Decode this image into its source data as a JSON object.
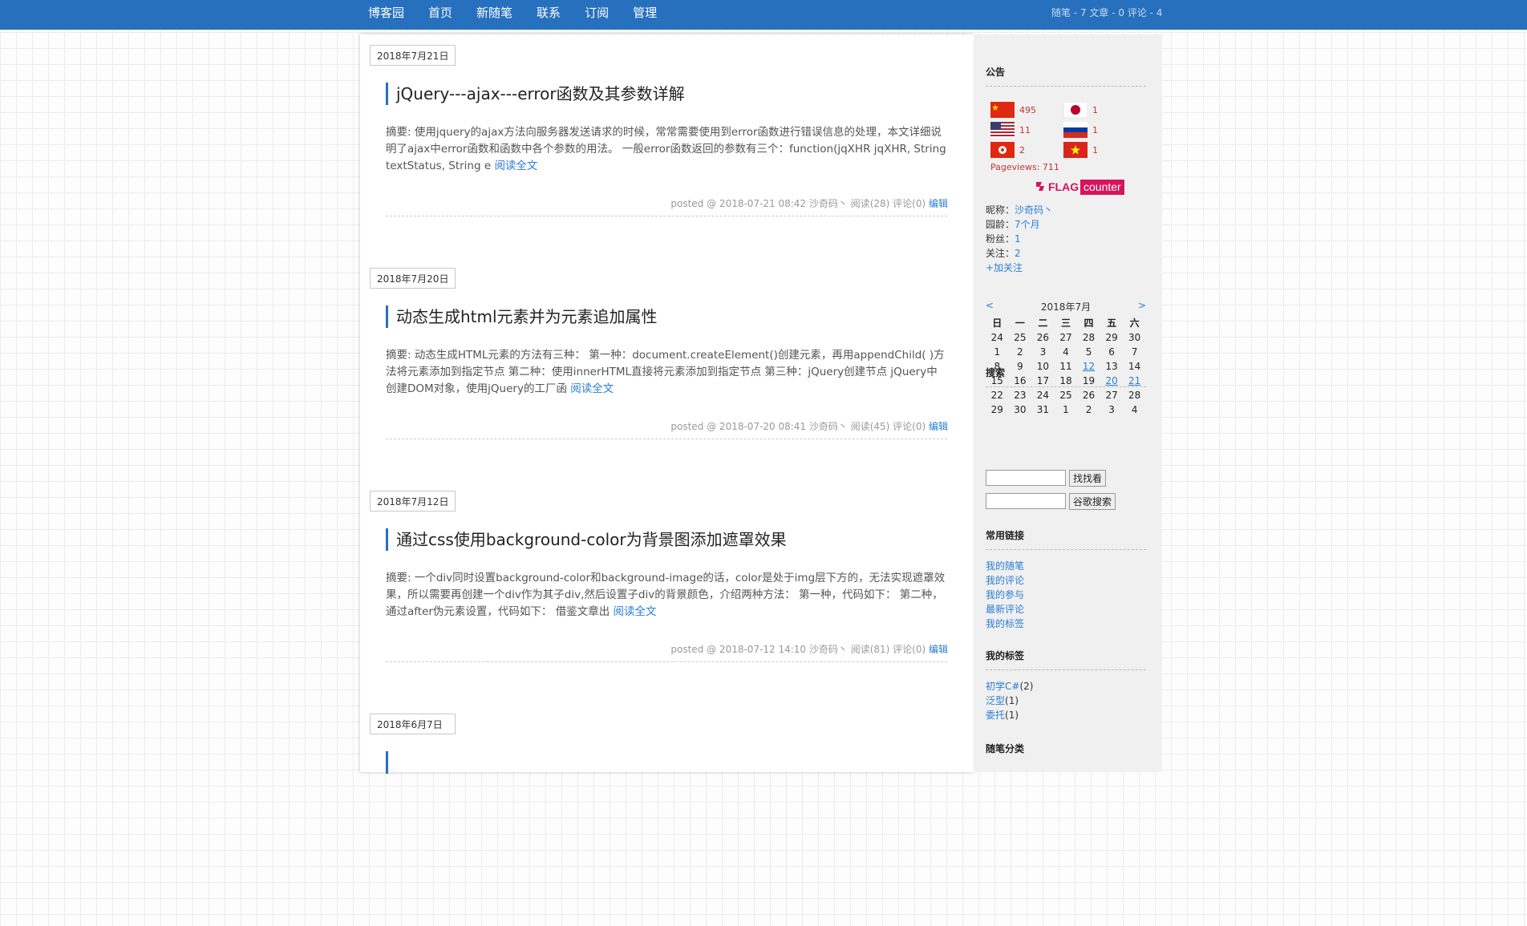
{
  "nav": {
    "items": [
      "博客园",
      "首页",
      "新随笔",
      "联系",
      "订阅",
      "管理"
    ],
    "stats": "随笔 - 7  文章 - 0  评论 - 4"
  },
  "posts": [
    {
      "date": "2018年7月21日",
      "title": "jQuery---ajax---error函数及其参数详解",
      "summary": "摘要: 使用jquery的ajax方法向服务器发送请求的时候，常常需要使用到error函数进行错误信息的处理，本文详细说明了ajax中error函数和函数中各个参数的用法。 一般error函数返回的参数有三个：function(jqXHR jqXHR, String textStatus, String e",
      "read_more": "阅读全文",
      "meta": "posted @ 2018-07-21 08:42 沙奇码丶 阅读(28) 评论(0)",
      "edit": "编辑"
    },
    {
      "date": "2018年7月20日",
      "title": "动态生成html元素并为元素追加属性",
      "summary": "摘要: 动态生成HTML元素的方法有三种： 第一种：document.createElement()创建元素，再用appendChild( )方法将元素添加到指定节点 第二种：使用innerHTML直接将元素添加到指定节点 第三种：jQuery创建节点 jQuery中创建DOM对象，使用jQuery的工厂函",
      "read_more": "阅读全文",
      "meta": "posted @ 2018-07-20 08:41 沙奇码丶 阅读(45) 评论(0)",
      "edit": "编辑"
    },
    {
      "date": "2018年7月12日",
      "title": "通过css使用background-color为背景图添加遮罩效果",
      "summary": "摘要: 一个div同时设置background-color和background-image的话，color是处于img层下方的，无法实现遮罩效果，所以需要再创建一个div作为其子div,然后设置子div的背景颜色，介绍两种方法： 第一种，代码如下： 第二种，通过after伪元素设置，代码如下： 借鉴文章出",
      "read_more": "阅读全文",
      "meta": "posted @ 2018-07-12 14:10 沙奇码丶 阅读(81) 评论(0)",
      "edit": "编辑"
    },
    {
      "date": "2018年6月7日",
      "title": "",
      "summary": "",
      "read_more": "",
      "meta": "",
      "edit": ""
    }
  ],
  "sidebar": {
    "notice_title": "公告",
    "flags": [
      {
        "country": "China",
        "count": "495"
      },
      {
        "country": "Japan",
        "count": "1"
      },
      {
        "country": "United States",
        "count": "11"
      },
      {
        "country": "Russia",
        "count": "1"
      },
      {
        "country": "Hong Kong",
        "count": "2"
      },
      {
        "country": "Vietnam",
        "count": "1"
      }
    ],
    "pageviews": "Pageviews: 711",
    "flag_counter": {
      "part1": "FLAG",
      "part2": "counter"
    },
    "profile": {
      "nickname_label": "昵称：",
      "nickname": "沙奇码丶",
      "age_label": "园龄：",
      "age": "7个月",
      "fans_label": "粉丝：",
      "fans": "1",
      "follow_label": "关注：",
      "follow": "2",
      "add_follow": "+加关注"
    },
    "calendar": {
      "prev": "<",
      "next": ">",
      "title": "2018年7月",
      "weekdays": [
        "日",
        "一",
        "二",
        "三",
        "四",
        "五",
        "六"
      ],
      "weeks": [
        [
          "24",
          "25",
          "26",
          "27",
          "28",
          "29",
          "30"
        ],
        [
          "1",
          "2",
          "3",
          "4",
          "5",
          "6",
          "7"
        ],
        [
          "8",
          "9",
          "10",
          "11",
          "12",
          "13",
          "14"
        ],
        [
          "15",
          "16",
          "17",
          "18",
          "19",
          "20",
          "21"
        ],
        [
          "22",
          "23",
          "24",
          "25",
          "26",
          "27",
          "28"
        ],
        [
          "29",
          "30",
          "31",
          "1",
          "2",
          "3",
          "4"
        ]
      ],
      "linked_days": [
        "12",
        "20",
        "21"
      ]
    },
    "search": {
      "title": "搜索",
      "btn1": "找找看",
      "btn2": "谷歌搜索"
    },
    "links": {
      "title": "常用链接",
      "items": [
        "我的随笔",
        "我的评论",
        "我的参与",
        "最新评论",
        "我的标签"
      ]
    },
    "tags": {
      "title": "我的标签",
      "items": [
        {
          "name": "初学C#",
          "count": "(2)"
        },
        {
          "name": "泛型",
          "count": "(1)"
        },
        {
          "name": "委托",
          "count": "(1)"
        }
      ]
    },
    "category_title": "随笔分类"
  }
}
